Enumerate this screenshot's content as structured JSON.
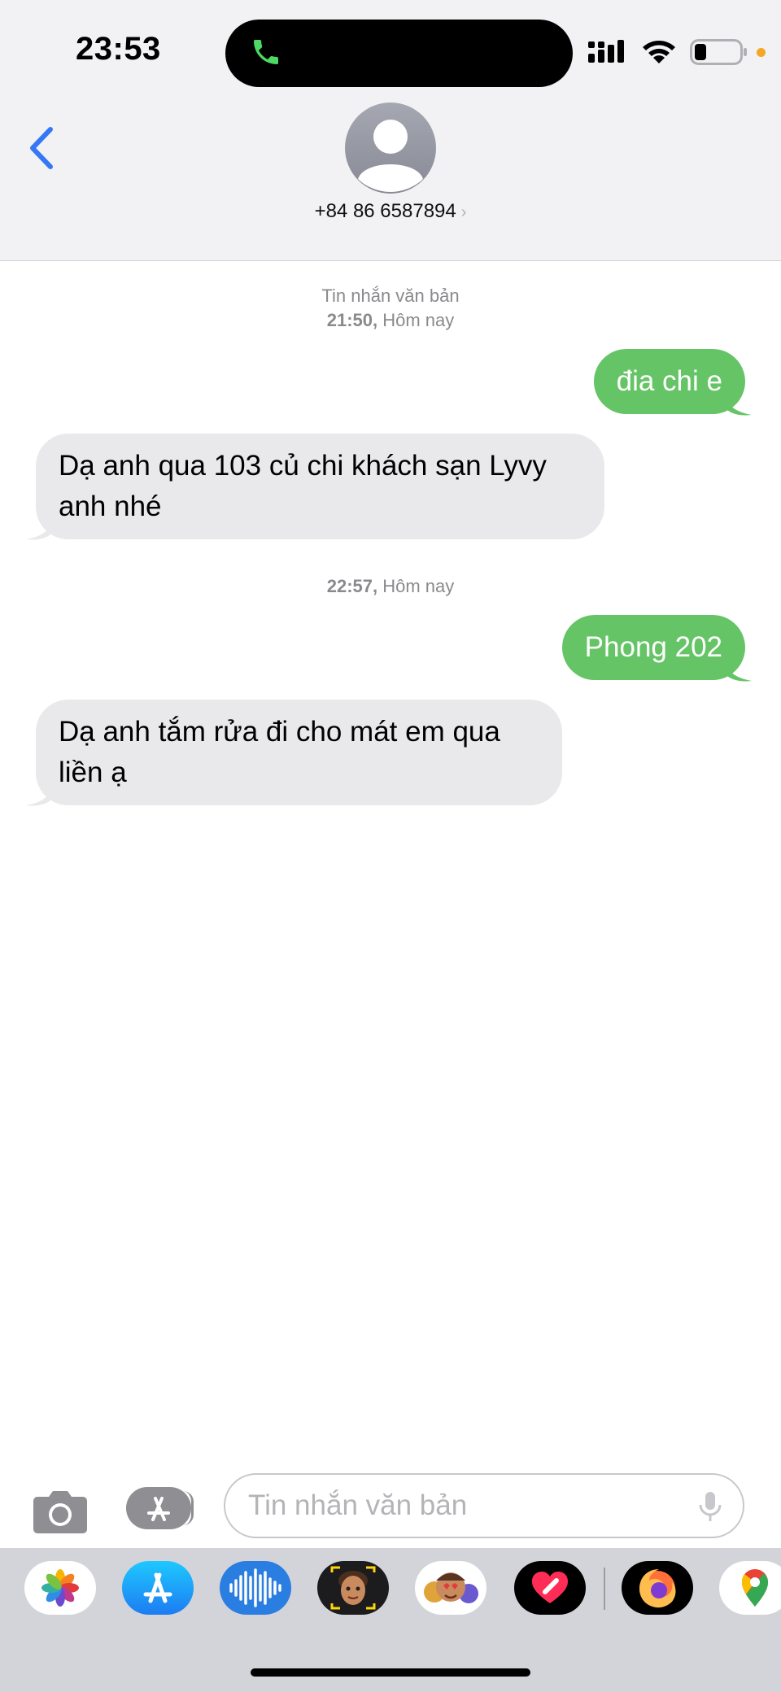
{
  "status_bar": {
    "time": "23:53"
  },
  "header": {
    "contact": "+84 86 6587894",
    "contact_chevron": "›",
    "back_icon": "chevron-left-icon",
    "avatar_icon": "person-icon"
  },
  "conversation": {
    "stamp1_label": "Tin nhắn văn bản",
    "stamp1_time": "21:50,",
    "stamp1_day": "Hôm nay",
    "stamp2_time": "22:57,",
    "stamp2_day": "Hôm nay",
    "messages": [
      {
        "direction": "outgoing",
        "text": "đia chi e"
      },
      {
        "direction": "incoming",
        "text": "Dạ anh qua 103 củ chi khách sạn Lyvy anh nhé"
      },
      {
        "direction": "outgoing",
        "text": "Phong 202"
      },
      {
        "direction": "incoming",
        "text": "Dạ anh tắm rửa đi cho mát em qua liền ạ"
      }
    ]
  },
  "composer": {
    "placeholder": "Tin nhắn văn bản",
    "camera_icon": "camera-icon",
    "apps_icon": "app-store-icon",
    "mic_icon": "microphone-icon"
  },
  "app_tray": [
    "photos-icon",
    "app-store-icon",
    "audio-message-icon",
    "memoji-icon",
    "animoji-stickers-icon",
    "digital-touch-icon",
    "firefox-icon",
    "google-maps-icon"
  ],
  "colors": {
    "outgoing": "#65c466",
    "incoming": "#e9e9eb",
    "accent": "#3478f6"
  }
}
